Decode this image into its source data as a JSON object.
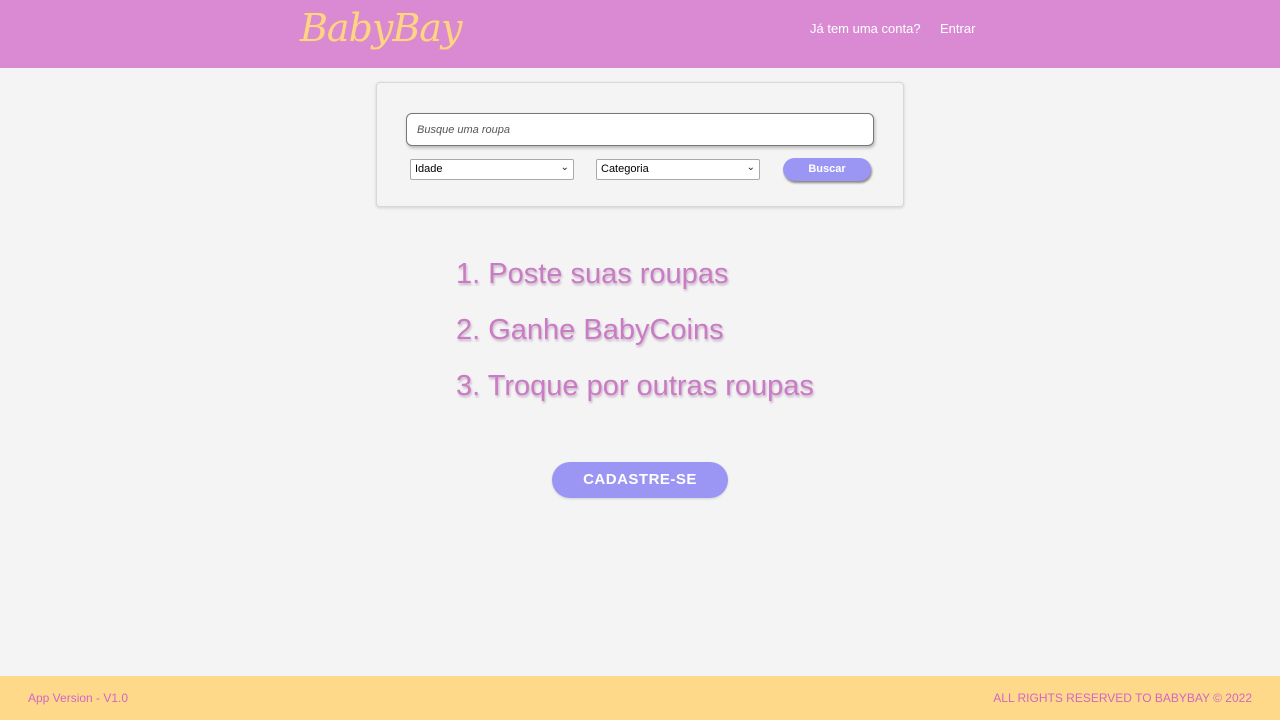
{
  "header": {
    "logo_text": "BabyBay",
    "question_text": "Já tem uma conta?",
    "login_link": "Entrar"
  },
  "search": {
    "placeholder": "Busque uma roupa",
    "age_select": {
      "selected": "Idade"
    },
    "category_select": {
      "selected": "Categoria"
    },
    "button_label": "Buscar"
  },
  "steps": [
    "1. Poste suas roupas",
    "2. Ganhe BabyCoins",
    "3. Troque por outras roupas"
  ],
  "cta": {
    "label": "CADASTRE-SE"
  },
  "footer": {
    "version": "App Version - V1.0",
    "rights": "ALL RIGHTS RESERVED TO BABYBAY © 2022"
  },
  "colors": {
    "header_bg": "#da8ad3",
    "logo": "#ffd38a",
    "accent_button": "#9b95f4",
    "steps_text": "#c97cc3",
    "footer_bg": "#ffd98a",
    "footer_text": "#d266c4"
  }
}
